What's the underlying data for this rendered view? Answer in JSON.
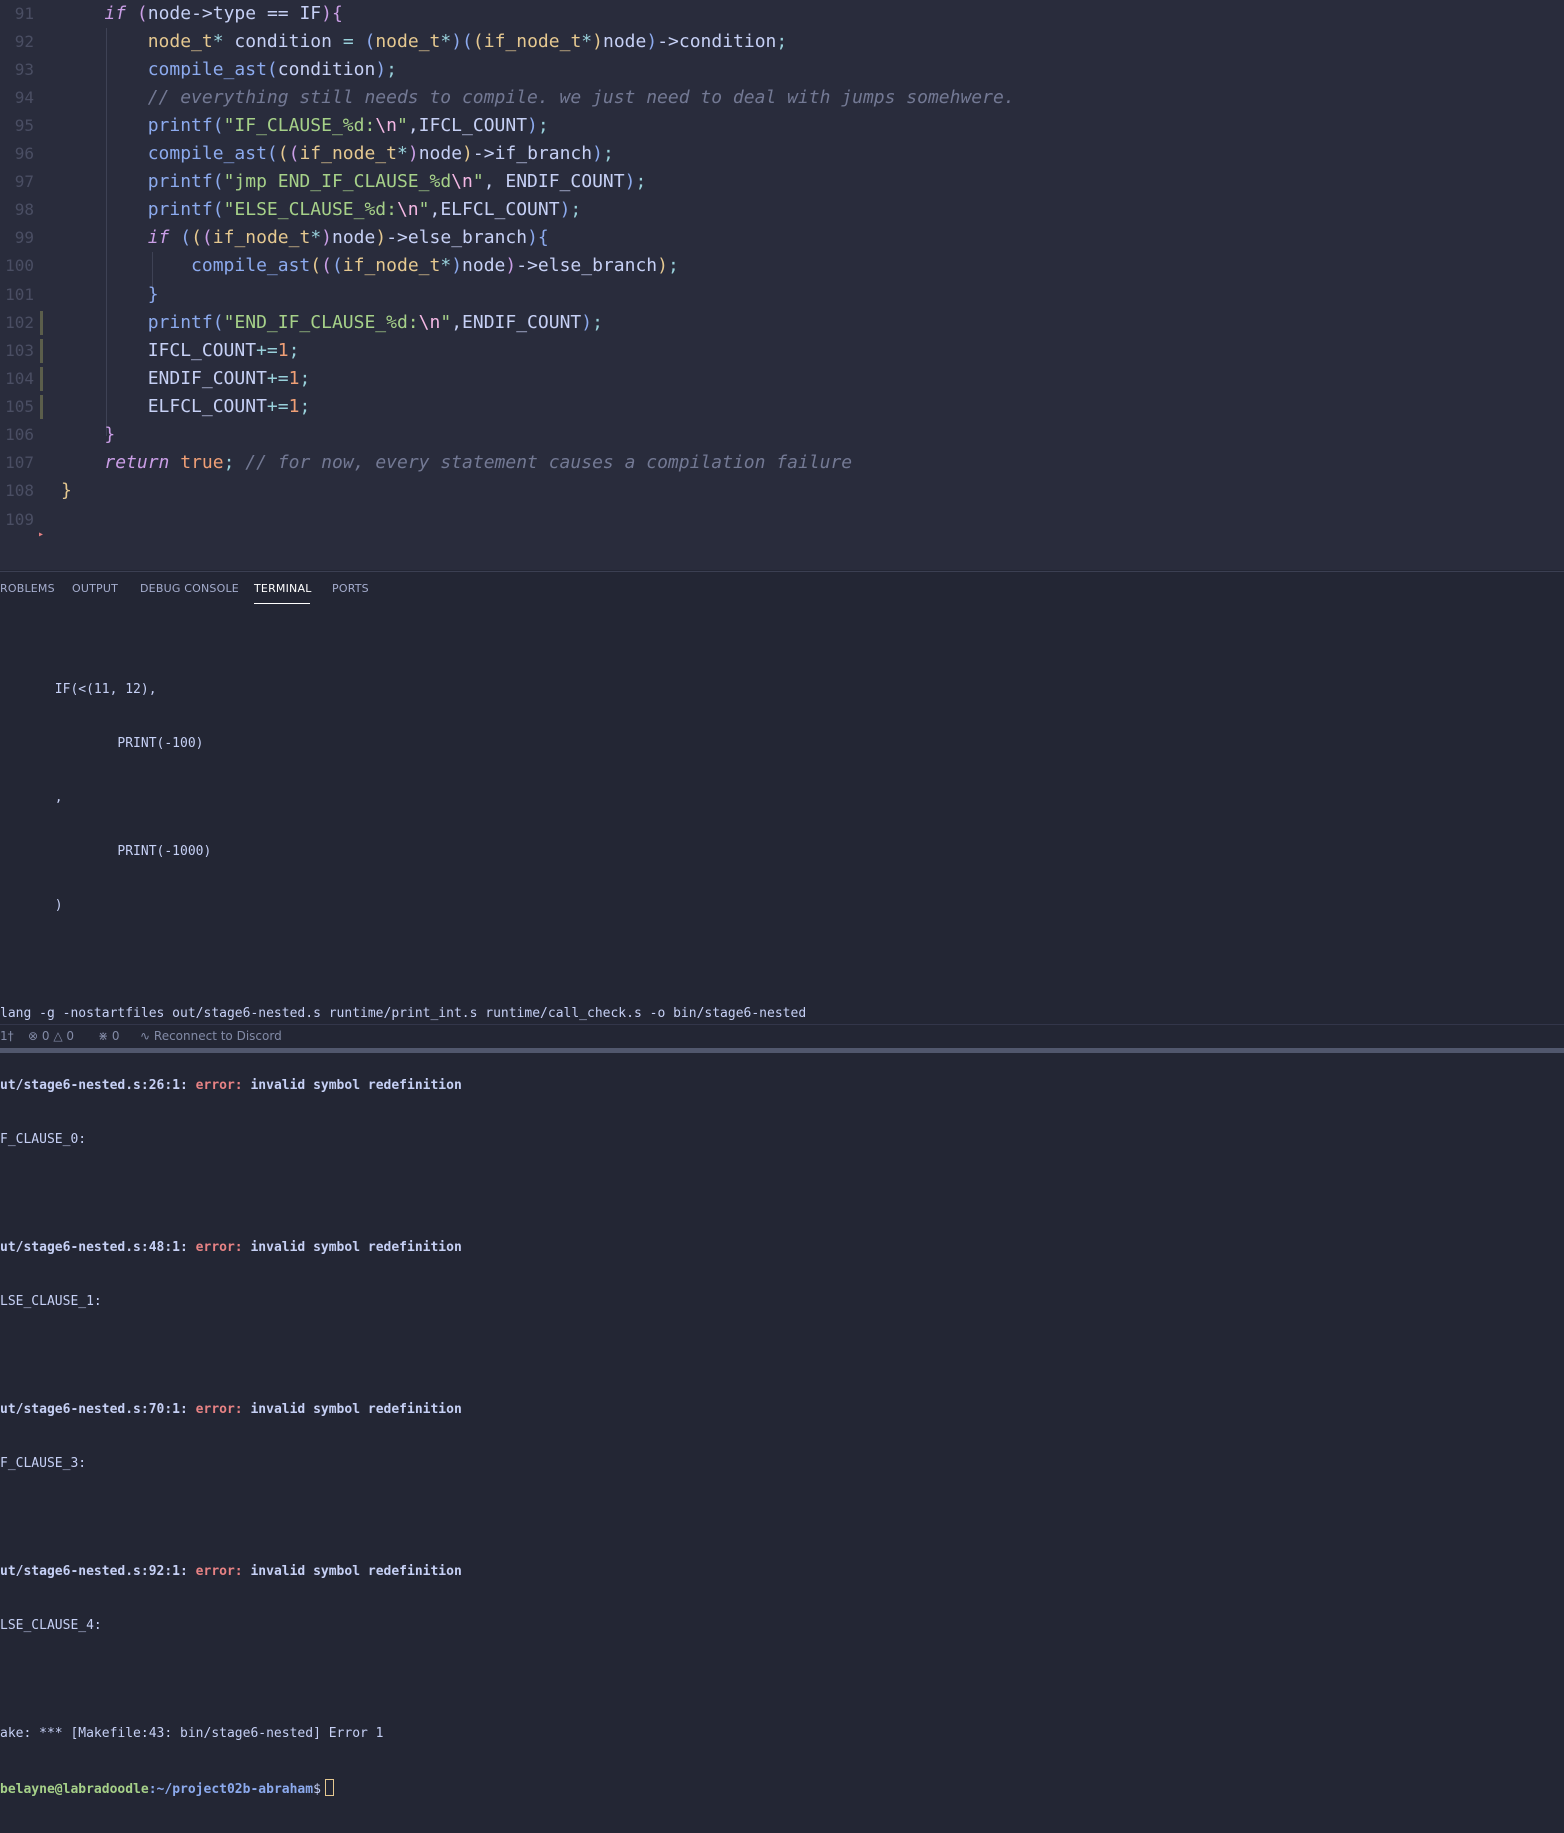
{
  "editor": {
    "lines": [
      {
        "n": "91"
      },
      {
        "n": "92"
      },
      {
        "n": "93"
      },
      {
        "n": "94"
      },
      {
        "n": "95"
      },
      {
        "n": "96"
      },
      {
        "n": "97"
      },
      {
        "n": "98"
      },
      {
        "n": "99"
      },
      {
        "n": "100"
      },
      {
        "n": "101"
      },
      {
        "n": "102"
      },
      {
        "n": "103"
      },
      {
        "n": "104"
      },
      {
        "n": "105"
      },
      {
        "n": "106"
      },
      {
        "n": "107"
      },
      {
        "n": "108"
      },
      {
        "n": "109"
      }
    ],
    "code": {
      "l91_if": "if",
      "l91_rest": "node->type == IF",
      "l92_type": "node_t",
      "l92_var": "condition",
      "l92_cast": "if_node_t",
      "l92_tail": "node",
      "l92_field": "->condition",
      "l93_fn": "compile_ast",
      "l93_arg": "condition",
      "l94_comment": "// everything still needs to compile. we just need to deal with jumps somehwere.",
      "l95_fn": "printf",
      "l95_str": "\"IF_CLAUSE_%d:",
      "l95_esc": "\\n",
      "l95_arg": "IFCL_COUNT",
      "l96_fn": "compile_ast",
      "l96_cast": "if_node_t",
      "l96_field": "->if_branch",
      "l97_fn": "printf",
      "l97_str": "\"jmp END_IF_CLAUSE_%d",
      "l97_esc": "\\n",
      "l97_arg": "ENDIF_COUNT",
      "l98_fn": "printf",
      "l98_str": "\"ELSE_CLAUSE_%d:",
      "l98_esc": "\\n",
      "l98_arg": "ELFCL_COUNT",
      "l99_if": "if",
      "l99_cast": "if_node_t",
      "l99_field": "->else_branch",
      "l100_fn": "compile_ast",
      "l100_cast": "if_node_t",
      "l100_field": "->else_branch",
      "l102_fn": "printf",
      "l102_str": "\"END_IF_CLAUSE_%d:",
      "l102_esc": "\\n",
      "l102_arg": "ENDIF_COUNT",
      "l103_var": "IFCL_COUNT",
      "l104_var": "ENDIF_COUNT",
      "l105_var": "ELFCL_COUNT",
      "num_one": "1",
      "node_word": "node",
      "l107_return": "return",
      "l107_true": "true",
      "l107_comment": "// for now, every statement causes a compilation failure"
    }
  },
  "panel": {
    "tabs": [
      {
        "label": "ROBLEMS"
      },
      {
        "label": "OUTPUT"
      },
      {
        "label": "DEBUG CONSOLE"
      },
      {
        "label": "TERMINAL"
      },
      {
        "label": "PORTS"
      }
    ],
    "active_tab": "TERMINAL"
  },
  "terminal": {
    "ast": [
      "       IF(<(11, 12),",
      "               PRINT(-100)",
      "       ,",
      "               PRINT(-1000)",
      "       )"
    ],
    "cmd": "lang -g -nostartfiles out/stage6-nested.s runtime/print_int.s runtime/call_check.s -o bin/stage6-nested",
    "errors": [
      {
        "loc": "ut/stage6-nested.s:26:1:",
        "msg": " invalid symbol redefinition",
        "sym": "F_CLAUSE_0:"
      },
      {
        "loc": "ut/stage6-nested.s:48:1:",
        "msg": " invalid symbol redefinition",
        "sym": "LSE_CLAUSE_1:"
      },
      {
        "loc": "ut/stage6-nested.s:70:1:",
        "msg": " invalid symbol redefinition",
        "sym": "F_CLAUSE_3:"
      },
      {
        "loc": "ut/stage6-nested.s:92:1:",
        "msg": " invalid symbol redefinition",
        "sym": "LSE_CLAUSE_4:"
      }
    ],
    "error_word": "error:",
    "make_line": "ake: *** [Makefile:43: bin/stage6-nested] Error 1",
    "prompt_user": "belayne@labradoodle",
    "prompt_path": ":~/project02b-abraham",
    "prompt_symbol": "$"
  },
  "statusbar": {
    "branch": "1†",
    "errors": "0",
    "warnings": "0",
    "ports": "0",
    "discord": "Reconnect to Discord"
  }
}
